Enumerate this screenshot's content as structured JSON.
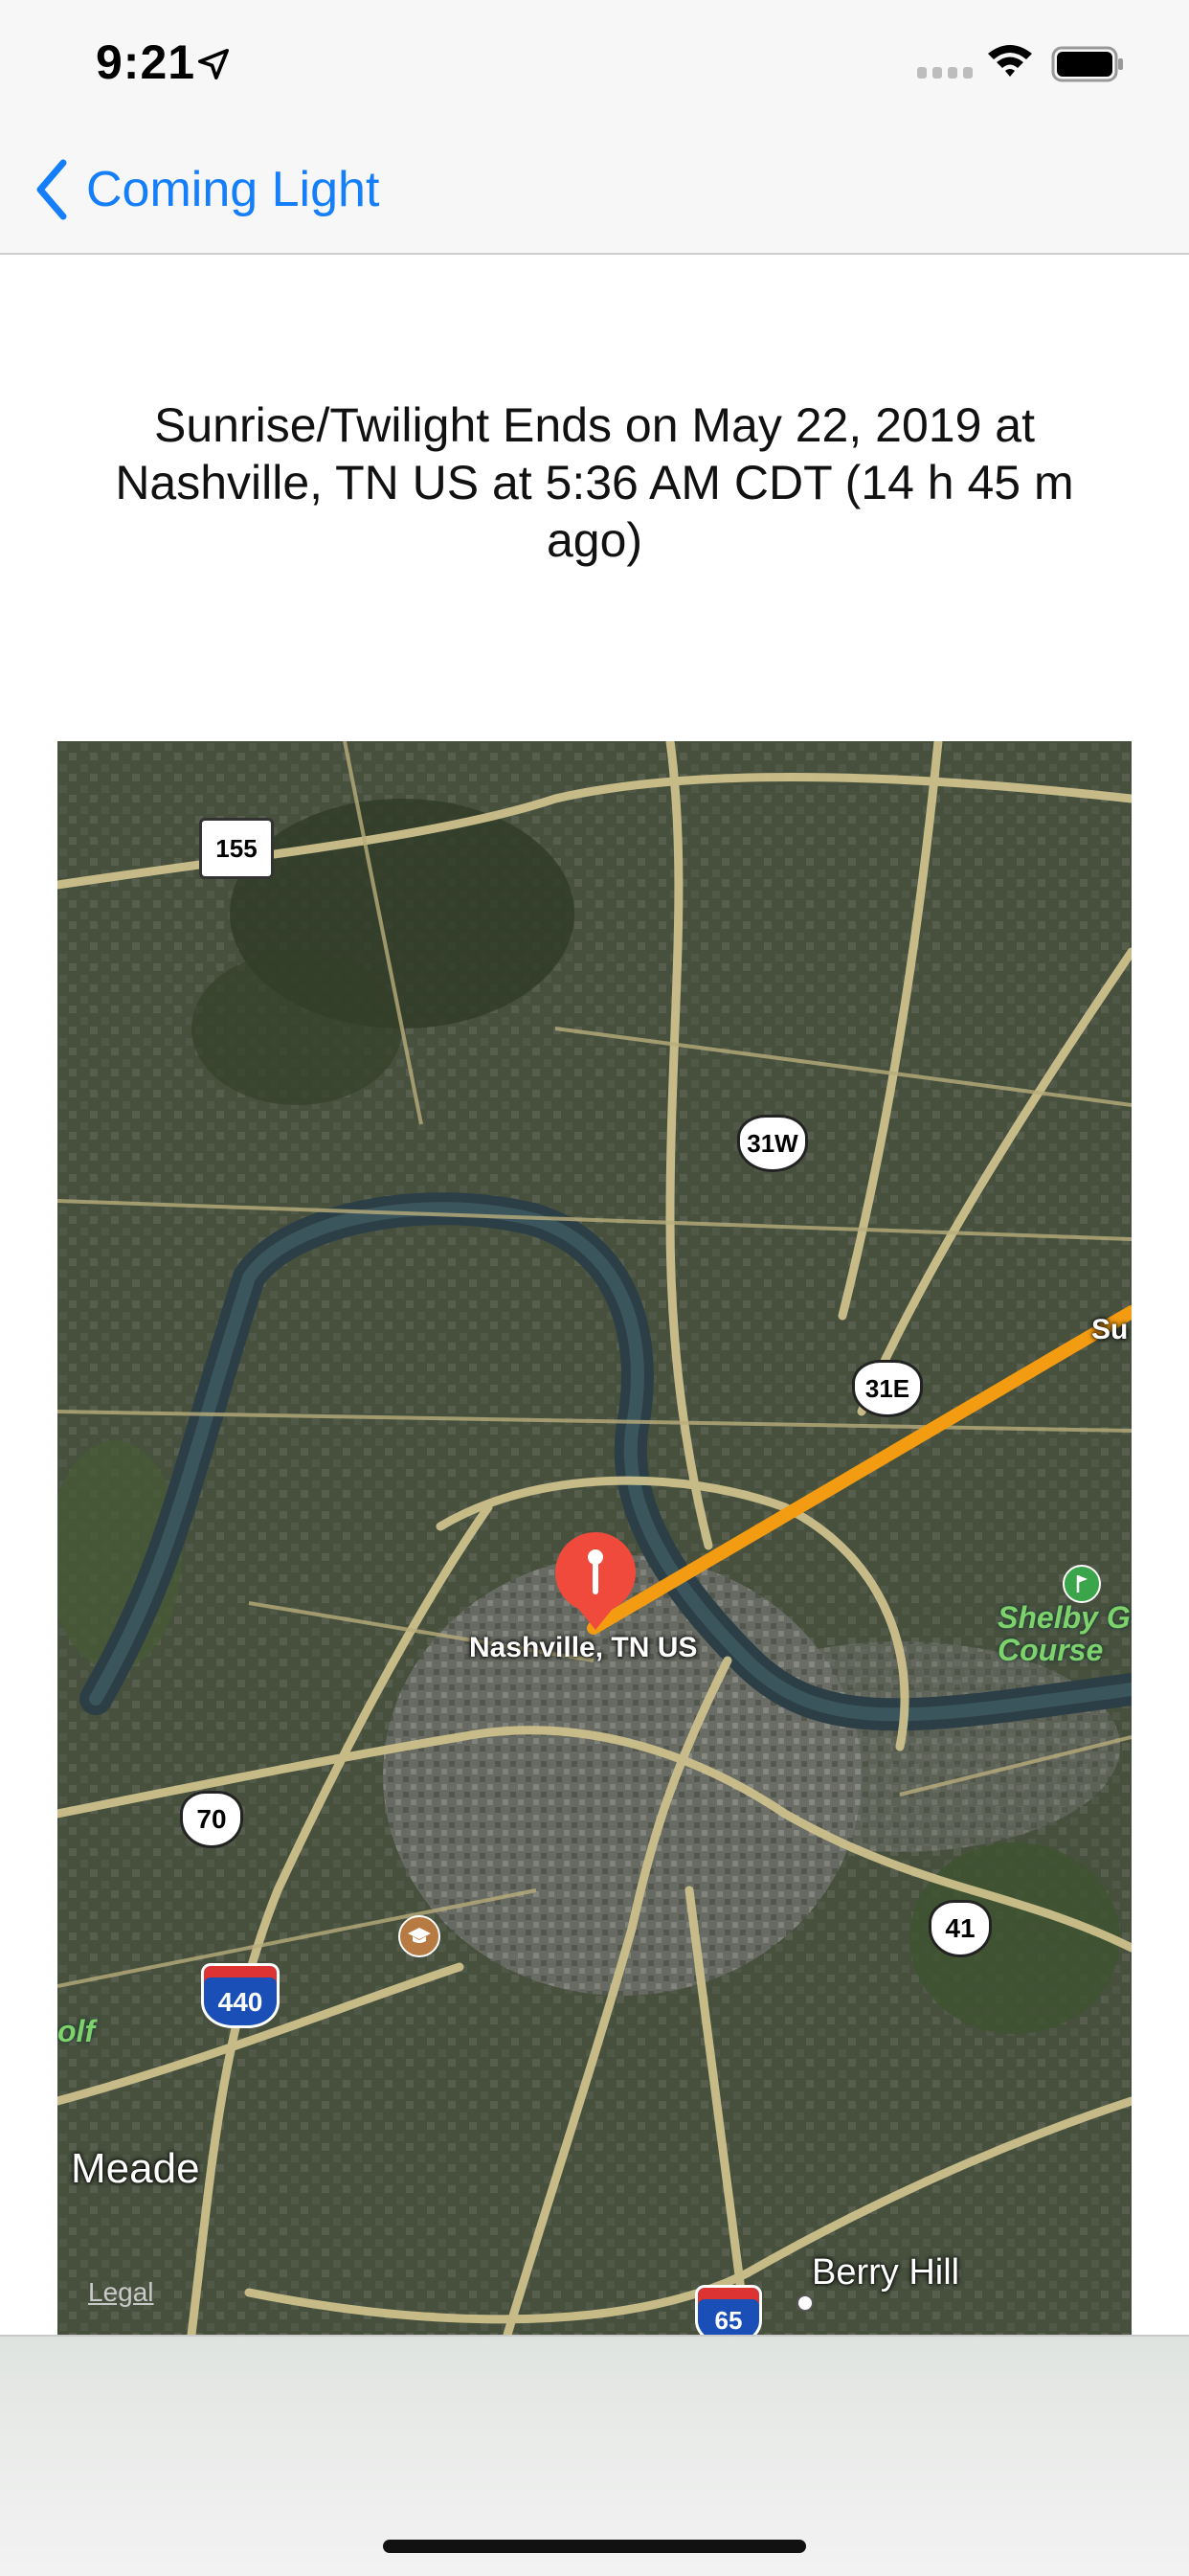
{
  "status_bar": {
    "time": "9:21"
  },
  "nav": {
    "back_label": "Coming Light"
  },
  "headline": "Sunrise/Twilight Ends on May 22, 2019 at Nashville, TN US at 5:36 AM CDT (14 h 45 m ago)",
  "map": {
    "pin_label": "Nashville, TN US",
    "shields": {
      "s155": "155",
      "s31w": "31W",
      "s31e": "31E",
      "s70": "70",
      "s41": "41",
      "s440": "440",
      "s65": "65"
    },
    "labels": {
      "sun_edge": "Su",
      "golf_course": "Shelby Go\nCourse",
      "golf_left": "olf",
      "meade": "Meade",
      "berry_hill": "Berry Hill",
      "legal": "Legal"
    },
    "colors": {
      "sun_line": "#f39c12",
      "pin": "#f04a3c"
    }
  }
}
